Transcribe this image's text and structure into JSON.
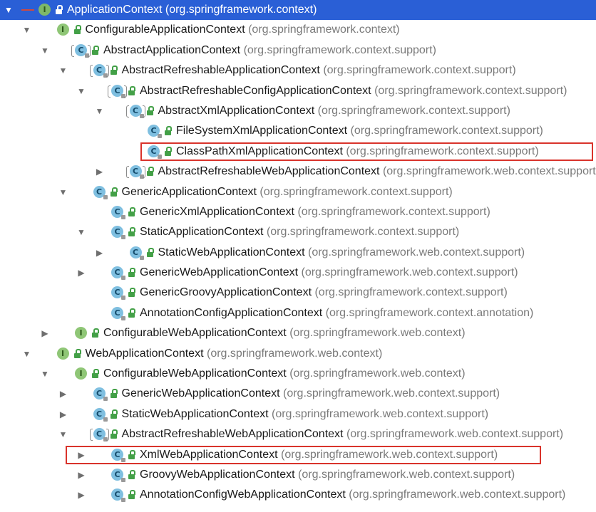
{
  "tree": {
    "items": [
      {
        "name": "ApplicationContext",
        "pkg": "(org.springframework.context)",
        "kind": "iface",
        "depth": 0,
        "arrow": "down",
        "selected": true
      },
      {
        "name": "ConfigurableApplicationContext",
        "pkg": "(org.springframework.context)",
        "kind": "iface",
        "depth": 1,
        "arrow": "down"
      },
      {
        "name": "AbstractApplicationContext",
        "pkg": "(org.springframework.context.support)",
        "kind": "abs",
        "depth": 2,
        "arrow": "down"
      },
      {
        "name": "AbstractRefreshableApplicationContext",
        "pkg": "(org.springframework.context.support)",
        "kind": "abs",
        "depth": 3,
        "arrow": "down"
      },
      {
        "name": "AbstractRefreshableConfigApplicationContext",
        "pkg": "(org.springframework.context.support)",
        "kind": "abs",
        "depth": 4,
        "arrow": "down"
      },
      {
        "name": "AbstractXmlApplicationContext",
        "pkg": "(org.springframework.context.support)",
        "kind": "abs",
        "depth": 5,
        "arrow": "down"
      },
      {
        "name": "FileSystemXmlApplicationContext",
        "pkg": "(org.springframework.context.support)",
        "kind": "cls",
        "depth": 6,
        "arrow": "none"
      },
      {
        "name": "ClassPathXmlApplicationContext",
        "pkg": "(org.springframework.context.support)",
        "kind": "cls",
        "depth": 6,
        "arrow": "none"
      },
      {
        "name": "AbstractRefreshableWebApplicationContext",
        "pkg": "(org.springframework.web.context.support)",
        "kind": "abs",
        "depth": 5,
        "arrow": "right"
      },
      {
        "name": "GenericApplicationContext",
        "pkg": "(org.springframework.context.support)",
        "kind": "cls",
        "depth": 3,
        "arrow": "down"
      },
      {
        "name": "GenericXmlApplicationContext",
        "pkg": "(org.springframework.context.support)",
        "kind": "cls",
        "depth": 4,
        "arrow": "none"
      },
      {
        "name": "StaticApplicationContext",
        "pkg": "(org.springframework.context.support)",
        "kind": "cls",
        "depth": 4,
        "arrow": "down"
      },
      {
        "name": "StaticWebApplicationContext",
        "pkg": "(org.springframework.web.context.support)",
        "kind": "cls",
        "depth": 5,
        "arrow": "right"
      },
      {
        "name": "GenericWebApplicationContext",
        "pkg": "(org.springframework.web.context.support)",
        "kind": "cls",
        "depth": 4,
        "arrow": "right"
      },
      {
        "name": "GenericGroovyApplicationContext",
        "pkg": "(org.springframework.context.support)",
        "kind": "cls",
        "depth": 4,
        "arrow": "none"
      },
      {
        "name": "AnnotationConfigApplicationContext",
        "pkg": "(org.springframework.context.annotation)",
        "kind": "cls",
        "depth": 4,
        "arrow": "none"
      },
      {
        "name": "ConfigurableWebApplicationContext",
        "pkg": "(org.springframework.web.context)",
        "kind": "iface",
        "depth": 2,
        "arrow": "right"
      },
      {
        "name": "WebApplicationContext",
        "pkg": "(org.springframework.web.context)",
        "kind": "iface",
        "depth": 1,
        "arrow": "down"
      },
      {
        "name": "ConfigurableWebApplicationContext",
        "pkg": "(org.springframework.web.context)",
        "kind": "iface",
        "depth": 2,
        "arrow": "down"
      },
      {
        "name": "GenericWebApplicationContext",
        "pkg": "(org.springframework.web.context.support)",
        "kind": "cls",
        "depth": 3,
        "arrow": "right"
      },
      {
        "name": "StaticWebApplicationContext",
        "pkg": "(org.springframework.web.context.support)",
        "kind": "cls",
        "depth": 3,
        "arrow": "right"
      },
      {
        "name": "AbstractRefreshableWebApplicationContext",
        "pkg": "(org.springframework.web.context.support)",
        "kind": "abs",
        "depth": 3,
        "arrow": "down"
      },
      {
        "name": "XmlWebApplicationContext",
        "pkg": "(org.springframework.web.context.support)",
        "kind": "cls",
        "depth": 4,
        "arrow": "right"
      },
      {
        "name": "GroovyWebApplicationContext",
        "pkg": "(org.springframework.web.context.support)",
        "kind": "cls",
        "depth": 4,
        "arrow": "right"
      },
      {
        "name": "AnnotationConfigWebApplicationContext",
        "pkg": "(org.springframework.web.context.support)",
        "kind": "cls",
        "depth": 4,
        "arrow": "right"
      }
    ]
  },
  "kind_letters": {
    "iface": "I",
    "cls": "C",
    "abs": "C"
  },
  "colors": {
    "selection": "#2a5fd6",
    "highlight_box": "#d9332b",
    "interface_icon": "#8fc676",
    "class_icon": "#7fbfe0",
    "public_lock": "#43a047",
    "package_text": "#7a7a7a"
  },
  "highlighted_items": [
    7,
    22
  ]
}
